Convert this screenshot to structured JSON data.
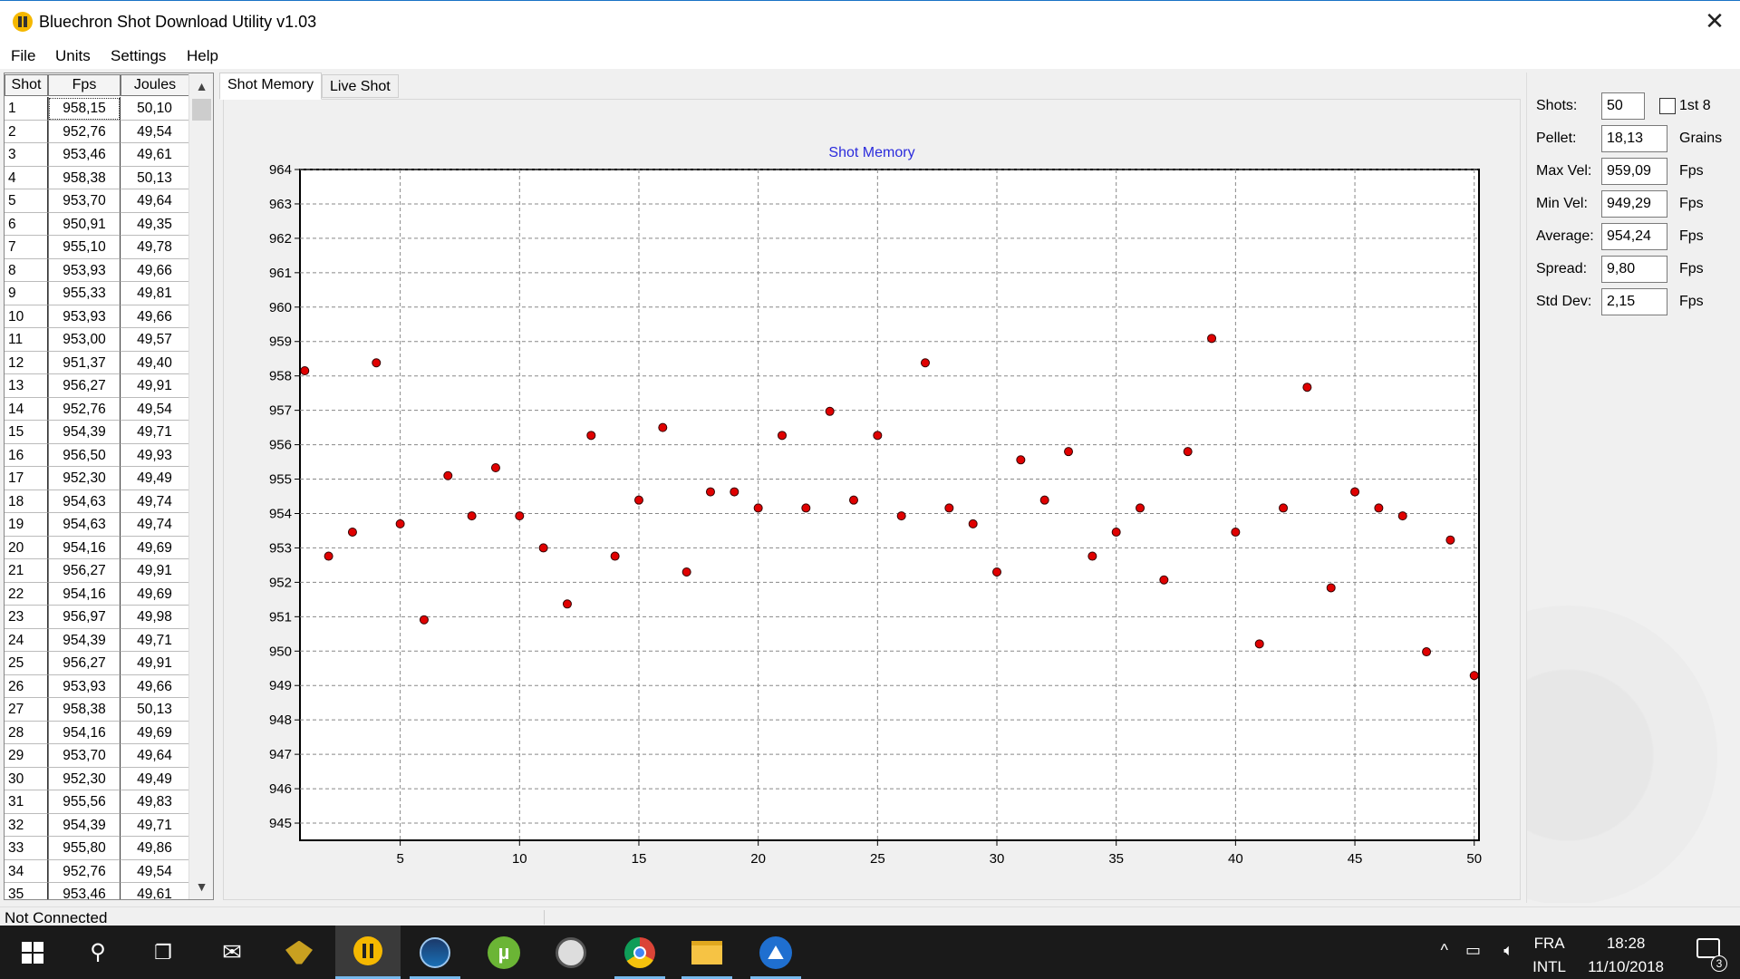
{
  "window": {
    "title": "Bluechron Shot Download Utility v1.03",
    "close_glyph": "✕"
  },
  "menu": [
    "File",
    "Units",
    "Settings",
    "Help"
  ],
  "table": {
    "headers": [
      "Shot",
      "Fps",
      "Joules"
    ],
    "rows": [
      [
        "1",
        "958,15",
        "50,10"
      ],
      [
        "2",
        "952,76",
        "49,54"
      ],
      [
        "3",
        "953,46",
        "49,61"
      ],
      [
        "4",
        "958,38",
        "50,13"
      ],
      [
        "5",
        "953,70",
        "49,64"
      ],
      [
        "6",
        "950,91",
        "49,35"
      ],
      [
        "7",
        "955,10",
        "49,78"
      ],
      [
        "8",
        "953,93",
        "49,66"
      ],
      [
        "9",
        "955,33",
        "49,81"
      ],
      [
        "10",
        "953,93",
        "49,66"
      ],
      [
        "11",
        "953,00",
        "49,57"
      ],
      [
        "12",
        "951,37",
        "49,40"
      ],
      [
        "13",
        "956,27",
        "49,91"
      ],
      [
        "14",
        "952,76",
        "49,54"
      ],
      [
        "15",
        "954,39",
        "49,71"
      ],
      [
        "16",
        "956,50",
        "49,93"
      ],
      [
        "17",
        "952,30",
        "49,49"
      ],
      [
        "18",
        "954,63",
        "49,74"
      ],
      [
        "19",
        "954,63",
        "49,74"
      ],
      [
        "20",
        "954,16",
        "49,69"
      ],
      [
        "21",
        "956,27",
        "49,91"
      ],
      [
        "22",
        "954,16",
        "49,69"
      ],
      [
        "23",
        "956,97",
        "49,98"
      ],
      [
        "24",
        "954,39",
        "49,71"
      ],
      [
        "25",
        "956,27",
        "49,91"
      ],
      [
        "26",
        "953,93",
        "49,66"
      ],
      [
        "27",
        "958,38",
        "50,13"
      ],
      [
        "28",
        "954,16",
        "49,69"
      ],
      [
        "29",
        "953,70",
        "49,64"
      ],
      [
        "30",
        "952,30",
        "49,49"
      ],
      [
        "31",
        "955,56",
        "49,83"
      ],
      [
        "32",
        "954,39",
        "49,71"
      ],
      [
        "33",
        "955,80",
        "49,86"
      ],
      [
        "34",
        "952,76",
        "49,54"
      ],
      [
        "35",
        "953,46",
        "49,61"
      ]
    ]
  },
  "tabs": [
    "Shot Memory",
    "Live Shot"
  ],
  "chart_data": {
    "type": "scatter",
    "title": "Shot Memory",
    "xlabel": "",
    "ylabel": "",
    "xlim": [
      1,
      50
    ],
    "ylim": [
      944.5,
      964
    ],
    "x_ticks": [
      5,
      10,
      15,
      20,
      25,
      30,
      35,
      40,
      45,
      50
    ],
    "y_ticks": [
      945,
      946,
      947,
      948,
      949,
      950,
      951,
      952,
      953,
      954,
      955,
      956,
      957,
      958,
      959,
      960,
      961,
      962,
      963,
      964
    ],
    "grid": true,
    "point_color": "#e00000",
    "series": [
      {
        "x": [
          1,
          2,
          3,
          4,
          5,
          6,
          7,
          8,
          9,
          10,
          11,
          12,
          13,
          14,
          15,
          16,
          17,
          18,
          19,
          20,
          21,
          22,
          23,
          24,
          25,
          26,
          27,
          28,
          29,
          30,
          31,
          32,
          33,
          34,
          35,
          36,
          37,
          38,
          39,
          40,
          41,
          42,
          43,
          44,
          45,
          46,
          47,
          48,
          49,
          50
        ],
        "y": [
          958.15,
          952.76,
          953.46,
          958.38,
          953.7,
          950.91,
          955.1,
          953.93,
          955.33,
          953.93,
          953.0,
          951.37,
          956.27,
          952.76,
          954.39,
          956.5,
          952.3,
          954.63,
          954.63,
          954.16,
          956.27,
          954.16,
          956.97,
          954.39,
          956.27,
          953.93,
          958.38,
          954.16,
          953.7,
          952.3,
          955.56,
          954.39,
          955.8,
          952.76,
          953.46,
          954.16,
          952.07,
          955.8,
          959.09,
          953.46,
          950.21,
          954.16,
          957.67,
          951.84,
          954.63,
          954.16,
          953.93,
          949.98,
          953.23,
          949.29
        ]
      }
    ]
  },
  "stats": {
    "shots_label": "Shots:",
    "shots_value": "50",
    "first8_label": "1st 8",
    "pellet_label": "Pellet:",
    "pellet_value": "18,13",
    "pellet_unit": "Grains",
    "maxvel_label": "Max Vel:",
    "maxvel_value": "959,09",
    "maxvel_unit": "Fps",
    "minvel_label": "Min Vel:",
    "minvel_value": "949,29",
    "minvel_unit": "Fps",
    "avg_label": "Average:",
    "avg_value": "954,24",
    "avg_unit": "Fps",
    "spread_label": "Spread:",
    "spread_value": "9,80",
    "spread_unit": "Fps",
    "std_label": "Std Dev:",
    "std_value": "2,15",
    "std_unit": "Fps"
  },
  "status": {
    "text": "Not Connected"
  },
  "taskbar": {
    "lang": "FRA",
    "layout": "INTL",
    "time": "18:28",
    "date": "11/10/2018",
    "notifications": "3",
    "icons": [
      "windows-start-icon",
      "search-icon",
      "task-view-icon",
      "mail-icon",
      "eagle-app-icon",
      "bluechron-icon",
      "steam-icon",
      "utorrent-icon",
      "monitor-app-icon",
      "chrome-icon",
      "file-explorer-icon",
      "vpn-app-icon"
    ]
  }
}
